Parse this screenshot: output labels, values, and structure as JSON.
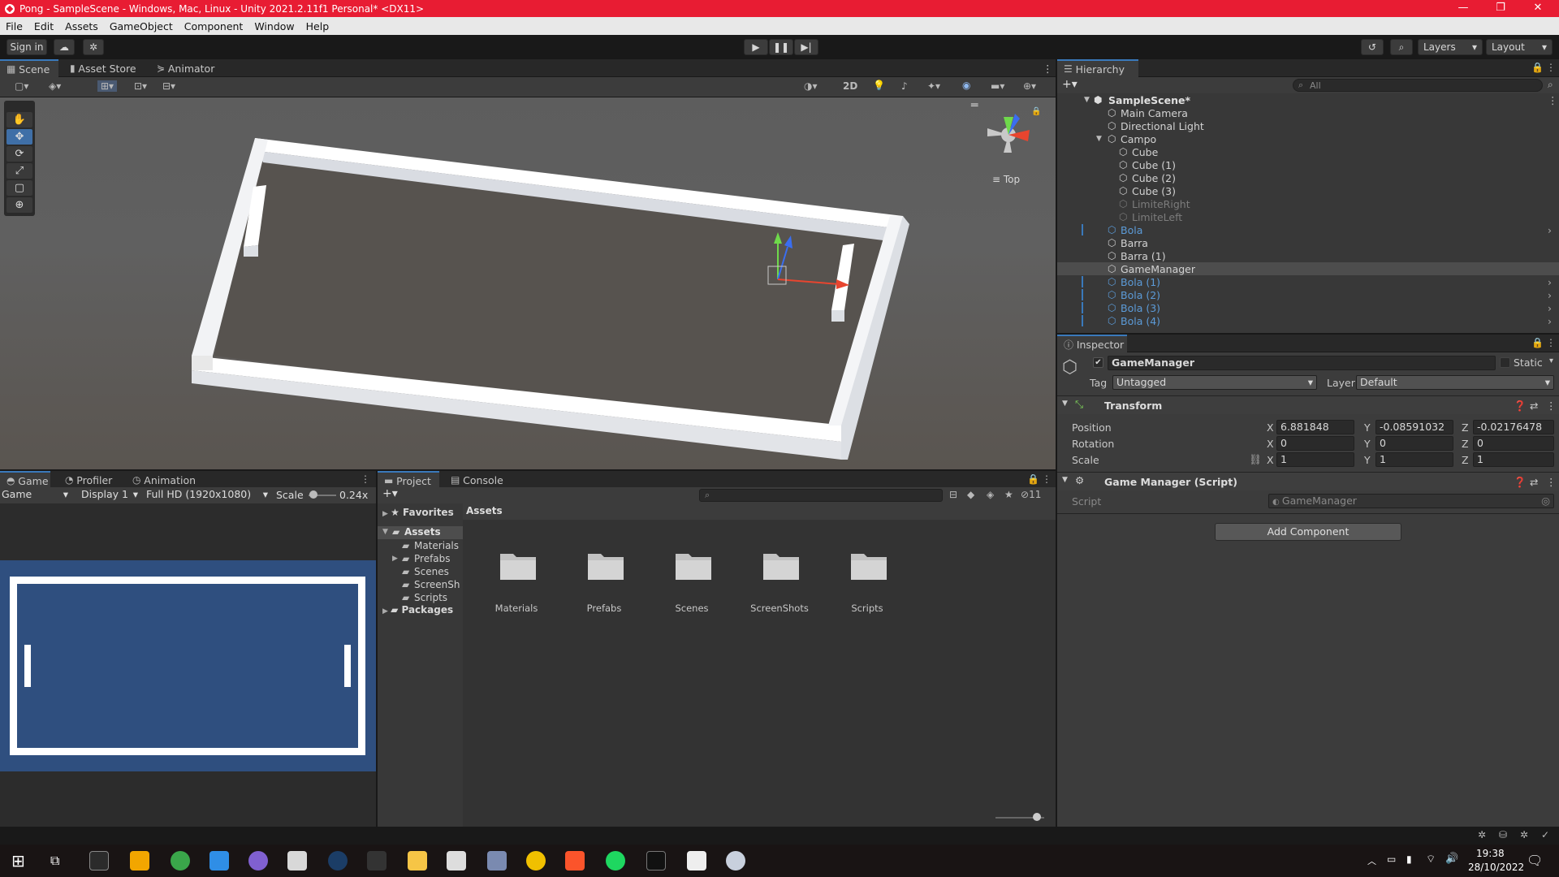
{
  "window": {
    "title": "Pong - SampleScene - Windows, Mac, Linux - Unity 2021.2.11f1 Personal* <DX11>",
    "controls": [
      "—",
      "❐",
      "✕"
    ]
  },
  "menu": [
    "File",
    "Edit",
    "Assets",
    "GameObject",
    "Component",
    "Window",
    "Help"
  ],
  "toolbar": {
    "sign_in": "Sign in",
    "layers": "Layers",
    "layout": "Layout"
  },
  "scene_panel": {
    "tabs": [
      "Scene",
      "Asset Store",
      "Animator"
    ],
    "mode_2d": "2D",
    "gizmo_label": "Top"
  },
  "game_panel": {
    "tabs": [
      "Game",
      "Profiler",
      "Animation"
    ],
    "view_dropdown": "Game",
    "display": "Display 1",
    "resolution": "Full HD (1920x1080)",
    "scale_label": "Scale",
    "scale_value": "0.24x"
  },
  "project_panel": {
    "tabs": [
      "Project",
      "Console"
    ],
    "hidden_count": "11",
    "favorites": "Favorites",
    "assets": "Assets",
    "tree_children": [
      "Materials",
      "Prefabs",
      "Scenes",
      "ScreenSh",
      "Scripts"
    ],
    "packages": "Packages",
    "breadcrumb": "Assets",
    "folders": [
      "Materials",
      "Prefabs",
      "Scenes",
      "ScreenShots",
      "Scripts"
    ]
  },
  "hierarchy": {
    "title": "Hierarchy",
    "search_placeholder": "All",
    "scene": "SampleScene*",
    "items": [
      {
        "name": "Main Camera",
        "depth": 1,
        "prefab": false,
        "disabled": false
      },
      {
        "name": "Directional Light",
        "depth": 1,
        "prefab": false,
        "disabled": false
      },
      {
        "name": "Campo",
        "depth": 1,
        "prefab": false,
        "disabled": false,
        "expanded": true
      },
      {
        "name": "Cube",
        "depth": 2,
        "prefab": false,
        "disabled": false
      },
      {
        "name": "Cube (1)",
        "depth": 2,
        "prefab": false,
        "disabled": false
      },
      {
        "name": "Cube (2)",
        "depth": 2,
        "prefab": false,
        "disabled": false
      },
      {
        "name": "Cube (3)",
        "depth": 2,
        "prefab": false,
        "disabled": false
      },
      {
        "name": "LimiteRight",
        "depth": 2,
        "prefab": false,
        "disabled": true
      },
      {
        "name": "LimiteLeft",
        "depth": 2,
        "prefab": false,
        "disabled": true
      },
      {
        "name": "Bola",
        "depth": 1,
        "prefab": true,
        "disabled": false
      },
      {
        "name": "Barra",
        "depth": 1,
        "prefab": false,
        "disabled": false
      },
      {
        "name": "Barra (1)",
        "depth": 1,
        "prefab": false,
        "disabled": false
      },
      {
        "name": "GameManager",
        "depth": 1,
        "prefab": false,
        "disabled": false,
        "selected": true
      },
      {
        "name": "Bola (1)",
        "depth": 1,
        "prefab": true,
        "disabled": false
      },
      {
        "name": "Bola (2)",
        "depth": 1,
        "prefab": true,
        "disabled": false
      },
      {
        "name": "Bola (3)",
        "depth": 1,
        "prefab": true,
        "disabled": false
      },
      {
        "name": "Bola (4)",
        "depth": 1,
        "prefab": true,
        "disabled": false
      }
    ]
  },
  "inspector": {
    "title": "Inspector",
    "object_name": "GameManager",
    "static_label": "Static",
    "tag_label": "Tag",
    "tag_value": "Untagged",
    "layer_label": "Layer",
    "layer_value": "Default",
    "transform": {
      "title": "Transform",
      "position_label": "Position",
      "rotation_label": "Rotation",
      "scale_label": "Scale",
      "position": {
        "x": "6.881848",
        "y": "-0.08591032",
        "z": "-0.02176478"
      },
      "rotation": {
        "x": "0",
        "y": "0",
        "z": "0"
      },
      "scale": {
        "x": "1",
        "y": "1",
        "z": "1"
      },
      "axis_x": "X",
      "axis_y": "Y",
      "axis_z": "Z"
    },
    "script_component": {
      "title": "Game Manager (Script)",
      "script_label": "Script",
      "script_value": "GameManager"
    },
    "add_component": "Add Component"
  },
  "taskbar": {
    "time": "19:38",
    "date": "28/10/2022"
  },
  "colors": {
    "title_bar": "#e81c33",
    "accent_blue": "#3a79bb",
    "game_bg": "#2f4f7f",
    "prefab_blue": "#5c9bd8"
  }
}
